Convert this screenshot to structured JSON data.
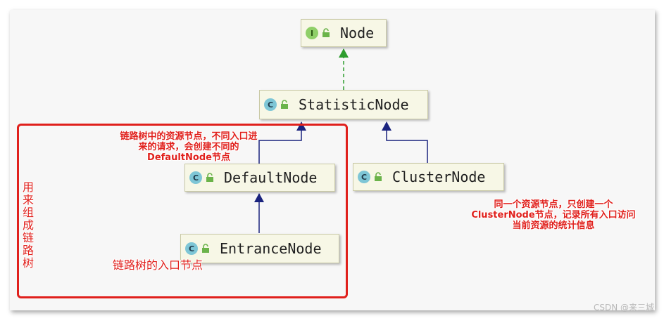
{
  "nodes": [
    {
      "id": "node",
      "name": "Node",
      "kind": "I"
    },
    {
      "id": "statistic-node",
      "name": "StatisticNode",
      "kind": "C"
    },
    {
      "id": "default-node",
      "name": "DefaultNode",
      "kind": "C"
    },
    {
      "id": "cluster-node",
      "name": "ClusterNode",
      "kind": "C"
    },
    {
      "id": "entrance-node",
      "name": "EntranceNode",
      "kind": "C"
    }
  ],
  "edges": [
    {
      "from": "StatisticNode",
      "to": "Node",
      "relation": "implements",
      "style": "dashed",
      "color": "#2e9d2e"
    },
    {
      "from": "DefaultNode",
      "to": "StatisticNode",
      "relation": "extends",
      "style": "solid",
      "color": "#1a237e"
    },
    {
      "from": "ClusterNode",
      "to": "StatisticNode",
      "relation": "extends",
      "style": "solid",
      "color": "#1a237e"
    },
    {
      "from": "EntranceNode",
      "to": "DefaultNode",
      "relation": "extends",
      "style": "solid",
      "color": "#1a237e"
    }
  ],
  "annotations": {
    "default_node_note": [
      "链路树中的资源节点，不同入口进",
      "来的请求，会创建不同的",
      "DefaultNode节点"
    ],
    "cluster_node_note": [
      "同一个资源节点，只创建一个",
      "ClusterNode节点，记录所有入口访问",
      "当前资源的统计信息"
    ],
    "entrance_node_note": "链路树的入口节点",
    "group_label": [
      "用来",
      "组成",
      "链路",
      "树"
    ]
  },
  "colors": {
    "annotation": "#e0201c",
    "implements_arrow": "#2e9d2e",
    "extends_arrow": "#1a237e"
  },
  "watermark": "CSDN @来三城"
}
